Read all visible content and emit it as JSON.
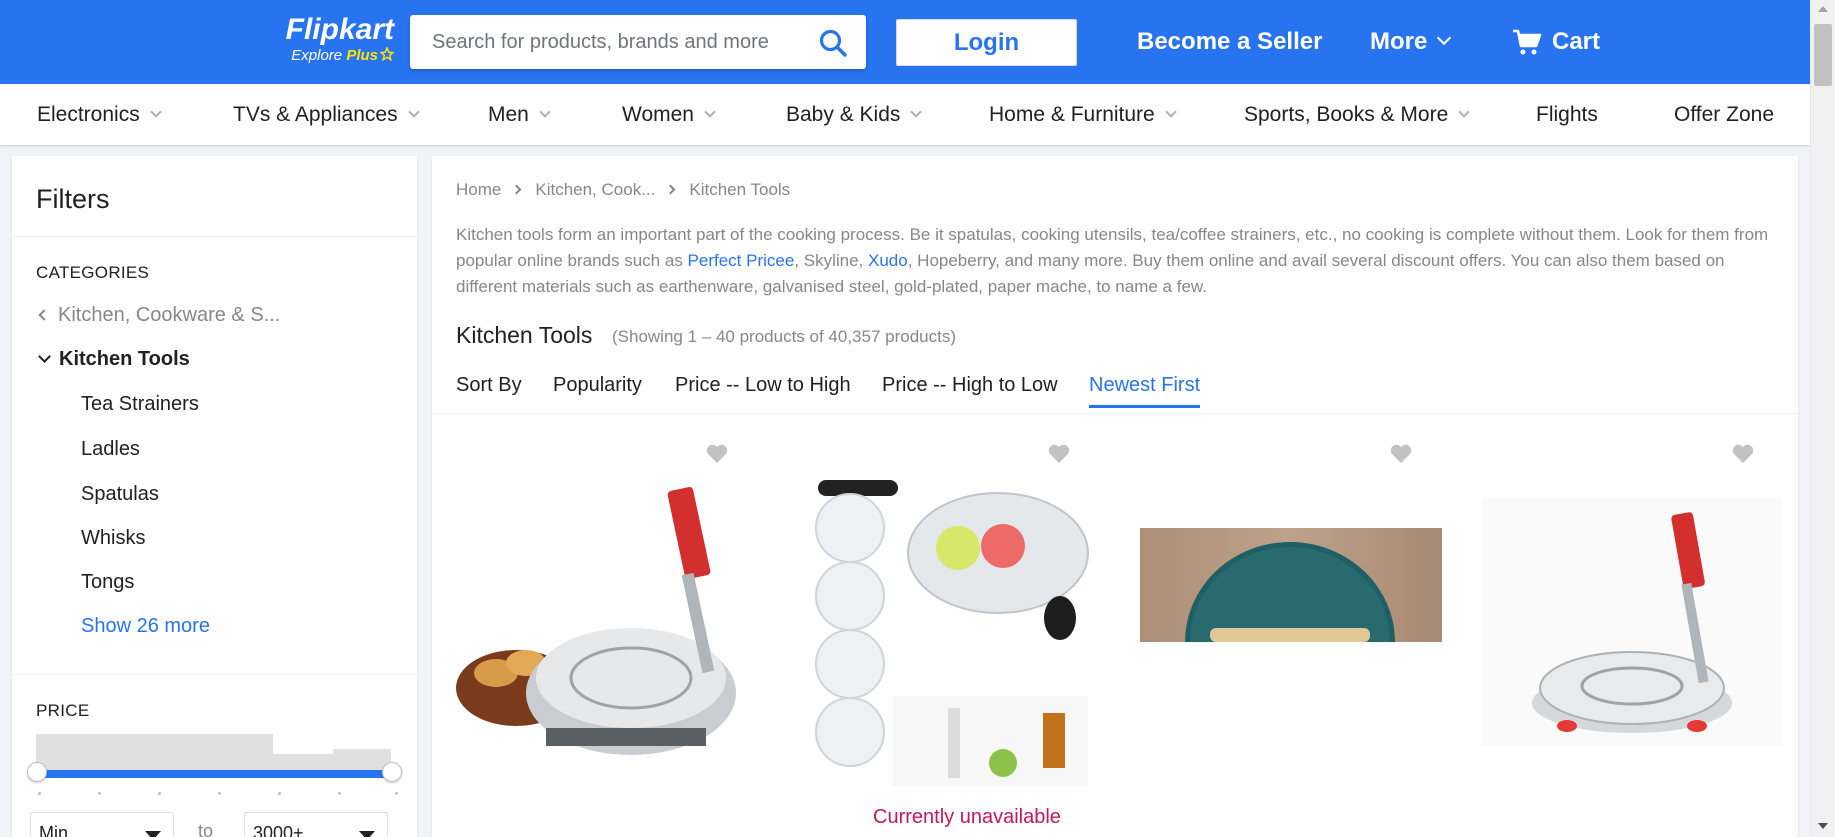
{
  "header": {
    "brand": "Flipkart",
    "tagline_prefix": "Explore",
    "tagline_plus": "Plus",
    "search_placeholder": "Search for products, brands and more",
    "login_label": "Login",
    "become_seller_label": "Become a Seller",
    "more_label": "More",
    "cart_label": "Cart",
    "brand_color": "#2874f0"
  },
  "category_nav": [
    {
      "label": "Electronics",
      "has_dropdown": true
    },
    {
      "label": "TVs & Appliances",
      "has_dropdown": true
    },
    {
      "label": "Men",
      "has_dropdown": true
    },
    {
      "label": "Women",
      "has_dropdown": true
    },
    {
      "label": "Baby & Kids",
      "has_dropdown": true
    },
    {
      "label": "Home & Furniture",
      "has_dropdown": true
    },
    {
      "label": "Sports, Books & More",
      "has_dropdown": true
    },
    {
      "label": "Flights",
      "has_dropdown": false
    },
    {
      "label": "Offer Zone",
      "has_dropdown": false
    }
  ],
  "filters": {
    "title": "Filters",
    "categories_heading": "CATEGORIES",
    "parent_category": "Kitchen, Cookware & S...",
    "current_category": "Kitchen Tools",
    "subcategories": [
      "Tea Strainers",
      "Ladles",
      "Spatulas",
      "Whisks",
      "Tongs"
    ],
    "show_more_label": "Show 26 more",
    "price_heading": "PRICE",
    "price_min_value": "Min",
    "price_to_label": "to",
    "price_max_value": "3000+"
  },
  "main": {
    "breadcrumb": [
      "Home",
      "Kitchen, Cook...",
      "Kitchen Tools"
    ],
    "description_parts": [
      {
        "text": "Kitchen tools form an important part of the cooking process. Be it spatulas, cooking utensils, tea/coffee strainers, etc., no cooking is complete without them. Look for them from popular online brands such as ",
        "link": false
      },
      {
        "text": "Perfect Pricee",
        "link": true
      },
      {
        "text": ", Skyline, ",
        "link": false
      },
      {
        "text": "Xudo",
        "link": true
      },
      {
        "text": ", Hopeberry, and many more. Buy them online and avail several discount offers. You can also them based on different materials such as earthenware, galvanised steel, gold-plated, paper mache, to name a few.",
        "link": false
      }
    ],
    "title": "Kitchen Tools",
    "count_text": "(Showing 1 – 40 products of 40,357 products)",
    "sort_by_label": "Sort By",
    "sort_options": [
      "Popularity",
      "Price -- Low to High",
      "Price -- High to Low",
      "Newest First"
    ],
    "active_sort": "Newest First",
    "products": [
      {
        "image": "puri-press-with-food",
        "status": ""
      },
      {
        "image": "ice-ball-mold-set",
        "status": "Currently unavailable"
      },
      {
        "image": "marble-board",
        "status": ""
      },
      {
        "image": "puri-press",
        "status": ""
      }
    ]
  }
}
